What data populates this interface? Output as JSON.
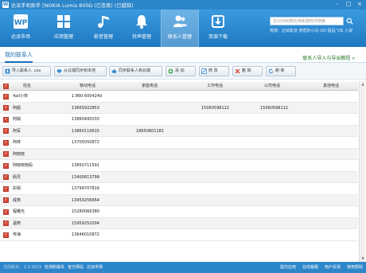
{
  "window": {
    "title": "达派手机助手 [NOKIA Lumia 800Ω (已连接) (已越狱)",
    "logo": "W",
    "controls": [
      "-",
      "□",
      "×"
    ]
  },
  "nav": {
    "items": [
      {
        "label": "达派市场",
        "icon": "wp-logo-icon"
      },
      {
        "label": "应用管理",
        "icon": "grid-apps-icon"
      },
      {
        "label": "影音管理",
        "icon": "music-film-icon"
      },
      {
        "label": "铃声管理",
        "icon": "bell-icon"
      },
      {
        "label": "联系人管理",
        "icon": "contacts-icon",
        "active": true
      },
      {
        "label": "资源下载",
        "icon": "download-icon"
      }
    ]
  },
  "search": {
    "placeholder": "在10090款应用和游戏中搜索",
    "hot_words": "热搜：达派影音 愤怒的小鸟 QQ 极品飞车 小说"
  },
  "subbar": {
    "tab": "我的联系人",
    "import_link": "联系人导入与导出教程 »"
  },
  "toolbar": {
    "buttons": [
      {
        "label": "导入联系人 .csv",
        "icon": "import-icon"
      },
      {
        "label": "从云端同步到本地",
        "icon": "cloud-down-icon"
      },
      {
        "label": "同步联系人到云端",
        "icon": "cloud-up-icon"
      },
      {
        "label": "添 加",
        "icon": "add-icon"
      },
      {
        "label": "修 改",
        "icon": "edit-icon"
      },
      {
        "label": "删 除",
        "icon": "delete-icon"
      },
      {
        "label": "刷 新",
        "icon": "refresh-icon"
      }
    ]
  },
  "table": {
    "columns": [
      "姓名",
      "移动电话",
      "家庭电话",
      "工作电话",
      "公司电话",
      "其他电话"
    ],
    "rows": [
      {
        "name": "4all小林",
        "mobile": "1 860 6004249",
        "home": "",
        "work": "",
        "company": "",
        "other": ""
      },
      {
        "name": "阿超",
        "mobile": "13665922853",
        "home": "",
        "work": "15060598112",
        "company": "15060598112",
        "other": ""
      },
      {
        "name": "阿娟",
        "mobile": "13860495033",
        "home": "",
        "work": "",
        "company": "",
        "other": ""
      },
      {
        "name": "阿军",
        "mobile": "13860119615",
        "home": "18650801181",
        "work": "",
        "company": "",
        "other": ""
      },
      {
        "name": "阿林",
        "mobile": "13705050872",
        "home": "",
        "work": "",
        "company": "",
        "other": ""
      },
      {
        "name": "阿晓晓",
        "mobile": "",
        "home": "",
        "work": "",
        "company": "",
        "other": ""
      },
      {
        "name": "阿晓晓她妈",
        "mobile": "13850711591",
        "home": "",
        "work": "",
        "company": "",
        "other": ""
      },
      {
        "name": "佩灵",
        "mobile": "13400613799",
        "home": "",
        "work": "",
        "company": "",
        "other": ""
      },
      {
        "name": "彩娟",
        "mobile": "13799707816",
        "home": "",
        "work": "",
        "company": "",
        "other": ""
      },
      {
        "name": "成燕",
        "mobile": "13459256664",
        "home": "",
        "work": "",
        "company": "",
        "other": ""
      },
      {
        "name": "程曙光",
        "mobile": "15280066380",
        "home": "",
        "work": "",
        "company": "",
        "other": ""
      },
      {
        "name": "温燕",
        "mobile": "15959252004",
        "home": "",
        "work": "",
        "company": "",
        "other": ""
      },
      {
        "name": "传海",
        "mobile": "13646010872",
        "home": "",
        "work": "",
        "company": "",
        "other": ""
      }
    ]
  },
  "footer": {
    "version": "当前版本:",
    "left_links": [
      "2.0.3623",
      "检测新版本",
      "官方网站",
      "达派市场"
    ],
    "right_links": [
      "提交应用",
      "在线客服",
      "用户反馈",
      "使用帮助"
    ]
  },
  "colors": {
    "accent": "#2d86c9",
    "checkbox": "#d64a3a",
    "tab": "#1f6fb5",
    "import_link": "#2a7a2a"
  }
}
